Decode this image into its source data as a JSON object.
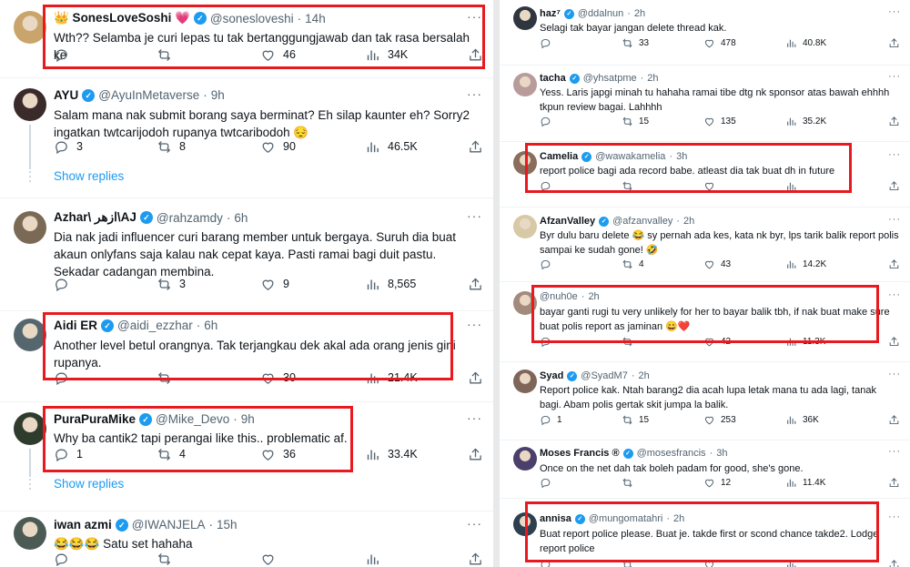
{
  "colors": {
    "accent": "#1d9bf0",
    "highlight_box": "#e8191f",
    "muted": "#536471"
  },
  "icons": {
    "reply": "reply-icon",
    "retweet": "retweet-icon",
    "like": "heart-icon",
    "views": "views-icon",
    "share": "share-icon",
    "more": "more-icon",
    "verified": "verified-icon"
  },
  "left": {
    "tweets": [
      {
        "name": "👑 SonesLoveSoshi 💗",
        "handle": "@sonesloveshi",
        "time": "14h",
        "text": "Wth?? Selamba je curi lepas tu tak bertanggungjawab dan tak rasa bersalah ke",
        "replies": "",
        "retweets": "",
        "likes": "46",
        "views": "34K"
      },
      {
        "name": "AYU",
        "handle": "@AyuInMetaverse",
        "time": "9h",
        "text": "Salam mana nak submit borang saya berminat? Eh silap kaunter eh? Sorry2 ingatkan twtcarijodoh rupanya twtcaribodoh 😔",
        "replies": "3",
        "retweets": "8",
        "likes": "90",
        "views": "46.5K",
        "show_replies": "Show replies"
      },
      {
        "name": "Azhar\\ ازهر\\AJ",
        "handle": "@rahzamdy",
        "time": "6h",
        "text": "Dia nak jadi influencer curi barang member untuk bergaya. Suruh dia buat akaun onlyfans saja kalau nak cepat kaya. Pasti ramai bagi duit pastu. Sekadar cadangan membina.",
        "replies": "",
        "retweets": "3",
        "likes": "9",
        "views": "8,565"
      },
      {
        "name": "Aidi ER",
        "handle": "@aidi_ezzhar",
        "time": "6h",
        "text": "Another level betul orangnya. Tak terjangkau dek akal ada orang jenis gini rupanya.",
        "replies": "",
        "retweets": "",
        "likes": "30",
        "views": "21.4K"
      },
      {
        "name": "PuraPuraMike",
        "handle": "@Mike_Devo",
        "time": "9h",
        "text": "Why ba cantik2 tapi perangai like this.. problematic af.",
        "replies": "1",
        "retweets": "4",
        "likes": "36",
        "views": "33.4K",
        "show_replies": "Show replies"
      },
      {
        "name": "iwan azmi",
        "handle": "@IWANJELA",
        "time": "15h",
        "text": "😂😂😂 Satu set hahaha",
        "replies": "",
        "retweets": "",
        "likes": "",
        "views": ""
      }
    ]
  },
  "right": {
    "tweets": [
      {
        "name": "haz⁷",
        "handle": "@ddalnun",
        "time": "2h",
        "text": "Selagi tak bayar jangan delete thread kak.",
        "replies": "",
        "retweets": "33",
        "likes": "478",
        "views": "40.8K"
      },
      {
        "name": "tacha",
        "handle": "@yhsatpme",
        "time": "2h",
        "text": "Yess. Laris japgi minah tu hahaha ramai tibe dtg nk sponsor atas bawah ehhhh tkpun review bagai. Lahhhh",
        "replies": "",
        "retweets": "15",
        "likes": "135",
        "views": "35.2K"
      },
      {
        "name": "Camelia",
        "handle": "@wawakamelia",
        "time": "3h",
        "text": "report police bagi ada record babe. atleast dia tak buat dh in future",
        "replies": "",
        "retweets": "",
        "likes": "",
        "views": ""
      },
      {
        "name": "AfzanValley",
        "handle": "@afzanvalley",
        "time": "2h",
        "text": "Byr dulu baru delete 😂 sy pernah ada kes, kata nk byr, lps tarik balik report polis sampai ke sudah gone! 🤣",
        "replies": "",
        "retweets": "4",
        "likes": "43",
        "views": "14.2K"
      },
      {
        "name": "",
        "handle": "@nuh0e",
        "time": "2h",
        "text": "bayar ganti rugi tu very unlikely for her to bayar balik tbh, if nak buat make sure buat polis report as jaminan 😄❤️",
        "replies": "",
        "retweets": "",
        "likes": "42",
        "views": "11.3K"
      },
      {
        "name": "Syad",
        "handle": "@SyadM7",
        "time": "2h",
        "text": "Report police kak. Ntah barang2 dia acah lupa letak mana tu ada lagi, tanak bagi. Abam polis gertak skit jumpa la balik.",
        "replies": "1",
        "retweets": "15",
        "likes": "253",
        "views": "36K"
      },
      {
        "name": "Moses Francis ®",
        "handle": "@mosesfrancis",
        "time": "3h",
        "text": "Once on the net dah tak boleh padam for good, she's gone.",
        "replies": "",
        "retweets": "",
        "likes": "12",
        "views": "11.4K"
      },
      {
        "name": "annisa",
        "handle": "@mungomatahri",
        "time": "2h",
        "text": "Buat report police please. Buat je. takde first or scond chance takde2. Lodge report police",
        "replies": "",
        "retweets": "",
        "likes": "",
        "views": ""
      }
    ]
  }
}
